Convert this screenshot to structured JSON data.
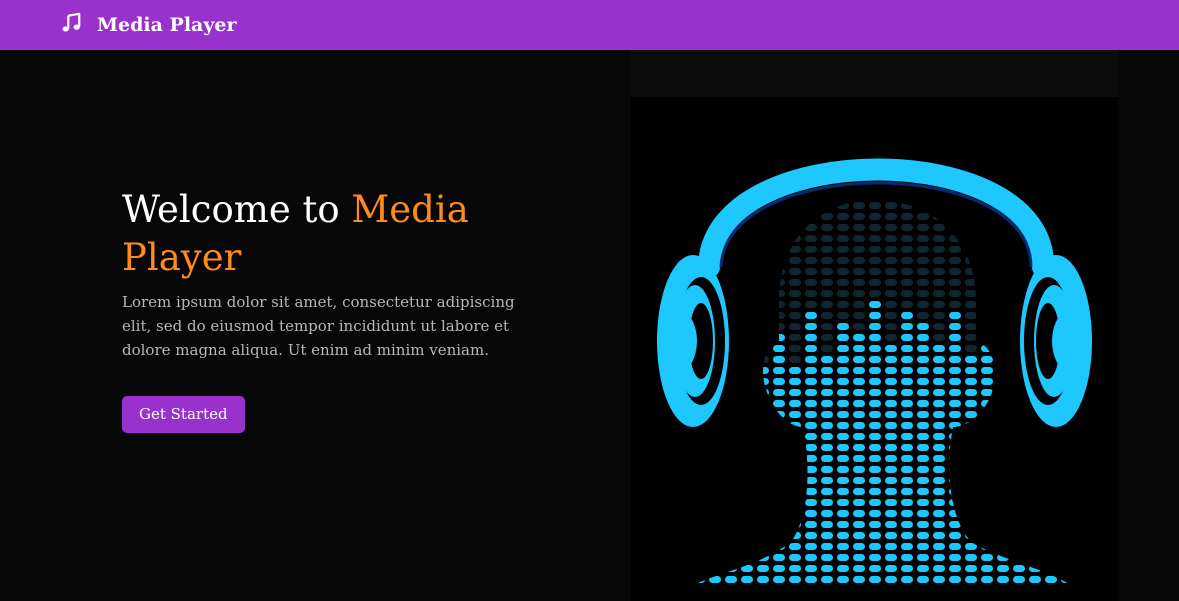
{
  "navbar": {
    "brand_icon": "music-note-icon",
    "brand_text": "Media Player",
    "background": "#9932cc"
  },
  "hero": {
    "title_main": "Welcome to ",
    "title_accent": "Media Player",
    "description": "Lorem ipsum dolor sit amet, consectetur adipiscing elit, sed do eiusmod tempor incididunt ut labore et dolore magna aliqua. Ut enim ad minim veniam.",
    "cta_label": "Get Started",
    "accent_color": "#ff8c1a",
    "button_color": "#9932cc"
  },
  "illustration": {
    "subject": "headphones-equalizer-head-image",
    "color": "#1ec8ff"
  }
}
